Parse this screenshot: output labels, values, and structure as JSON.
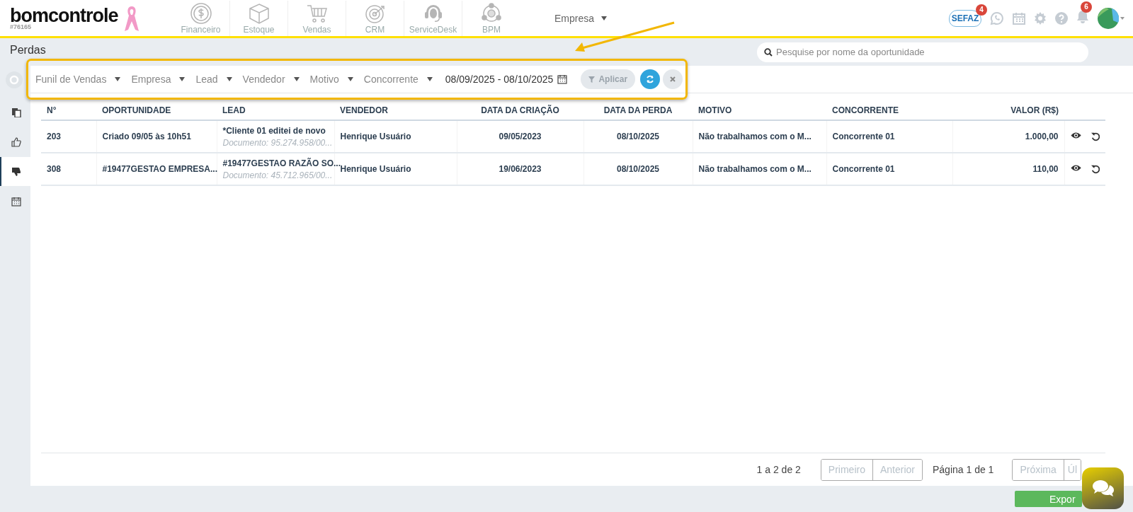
{
  "app": {
    "logo": "bomcontrole",
    "account": "#76165"
  },
  "nav": [
    {
      "label": "Financeiro",
      "kind": "money"
    },
    {
      "label": "Estoque",
      "kind": "box"
    },
    {
      "label": "Vendas",
      "kind": "cart"
    },
    {
      "label": "CRM",
      "kind": "target"
    },
    {
      "label": "ServiceDesk",
      "kind": "headset"
    },
    {
      "label": "BPM",
      "kind": "network"
    }
  ],
  "company_menu": {
    "label": "Empresa"
  },
  "toolbar": {
    "sefaz_label": "SEFAZ",
    "sefaz_badge": "4",
    "notifications_badge": "6"
  },
  "page": {
    "title": "Perdas"
  },
  "search": {
    "placeholder": "Pesquise por nome da oportunidade"
  },
  "sidebar": [
    {
      "kind": "copy",
      "selected": false
    },
    {
      "kind": "thumbs_up",
      "selected": false
    },
    {
      "kind": "thumbs_down",
      "selected": true
    },
    {
      "kind": "calendar",
      "selected": false
    }
  ],
  "filters": [
    {
      "label": "Funil de Vendas"
    },
    {
      "label": "Empresa"
    },
    {
      "label": "Lead"
    },
    {
      "label": "Vendedor"
    },
    {
      "label": "Motivo"
    },
    {
      "label": "Concorrente"
    }
  ],
  "date_range": "08/09/2025 - 08/10/2025",
  "filter_actions": {
    "apply": {
      "label": "Aplicar",
      "disabled": true
    }
  },
  "table": {
    "columns": [
      {
        "label": "N°"
      },
      {
        "label": "OPORTUNIDADE"
      },
      {
        "label": "LEAD"
      },
      {
        "label": "VENDEDOR"
      },
      {
        "label": "DATA DA CRIAÇÃO"
      },
      {
        "label": "DATA DA PERDA"
      },
      {
        "label": "MOTIVO"
      },
      {
        "label": "CONCORRENTE"
      },
      {
        "label": "VALOR (R$)"
      }
    ],
    "rows": [
      {
        "cells": [
          {
            "text": "203"
          },
          {
            "text": "Criado 09/05 às 10h51"
          },
          {
            "text": "*Cliente 01 editei de novo",
            "subtext": "Documento: 95.274.958/00..."
          },
          {
            "text": "Henrique Usuário"
          },
          {
            "text": "09/05/2023"
          },
          {
            "text": "08/10/2025"
          },
          {
            "text": "Não trabalhamos com o M..."
          },
          {
            "text": "Concorrente 01"
          },
          {
            "text": "1.000,00"
          }
        ]
      },
      {
        "cells": [
          {
            "text": "308"
          },
          {
            "text": "#19477GESTAO EMPRESA..."
          },
          {
            "text": "#19477GESTAO RAZÃO SO...",
            "subtext": "Documento: 45.712.965/00..."
          },
          {
            "text": "Henrique Usuário"
          },
          {
            "text": "19/06/2023"
          },
          {
            "text": "08/10/2025"
          },
          {
            "text": "Não trabalhamos com o M..."
          },
          {
            "text": "Concorrente 01"
          },
          {
            "text": "110,00"
          }
        ]
      }
    ]
  },
  "pagination": {
    "summary": "1 a 2 de 2",
    "page": "Página 1 de 1",
    "prev_buttons": [
      {
        "label": "Primeiro",
        "disabled": true
      },
      {
        "label": "Anterior",
        "disabled": true
      }
    ],
    "next_buttons": [
      {
        "label": "Próxima",
        "disabled": true
      },
      {
        "label": "Úl",
        "disabled": true
      }
    ]
  },
  "export_button": {
    "label": "Expor"
  }
}
